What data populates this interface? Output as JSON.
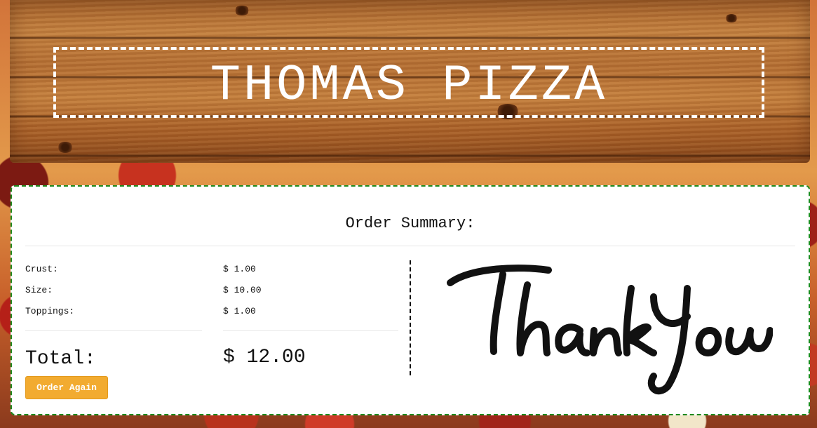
{
  "header": {
    "title": "THOMAS PIZZA"
  },
  "summary": {
    "title": "Order Summary:",
    "lines": [
      {
        "label": "Crust:",
        "price": "$ 1.00"
      },
      {
        "label": "Size:",
        "price": "$ 10.00"
      },
      {
        "label": "Toppings:",
        "price": "$ 1.00"
      }
    ],
    "total_label": "Total:",
    "total_value": "$ 12.00",
    "button_label": "Order Again"
  },
  "thank_you_image": "Thank You",
  "colors": {
    "button": "#f2ab30",
    "card_border": "#1e8a1e",
    "banner_text": "#ffffff"
  }
}
